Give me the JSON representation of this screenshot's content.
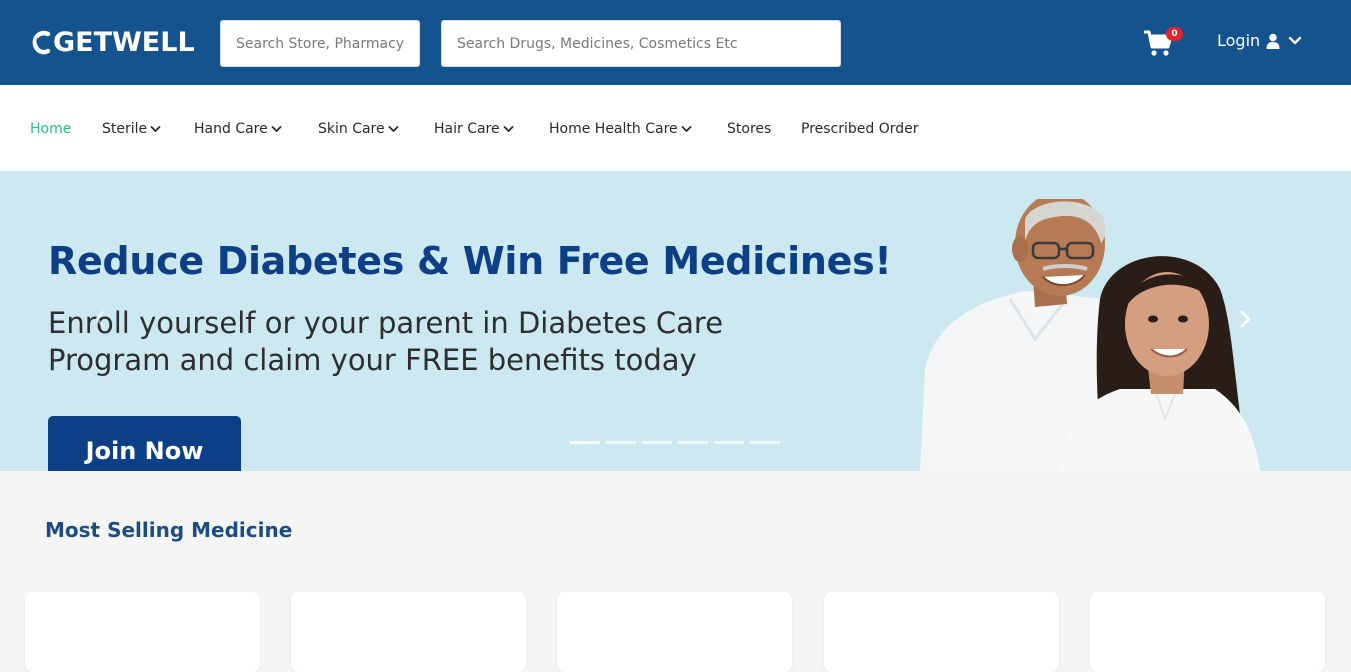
{
  "header": {
    "logo_text": "GETWELL",
    "store_search_placeholder": "Search Store, Pharmacy",
    "drug_search_placeholder": "Search Drugs, Medicines, Cosmetics Etc",
    "cart_count": "0",
    "login_label": "Login"
  },
  "nav": {
    "items": [
      {
        "label": "Home",
        "active": true
      },
      {
        "label": "Sterile",
        "dropdown": true
      },
      {
        "label": "Hand Care",
        "dropdown": true
      },
      {
        "label": "Skin Care",
        "dropdown": true
      },
      {
        "label": "Hair Care",
        "dropdown": true
      },
      {
        "label": "Home Health Care",
        "dropdown": true
      },
      {
        "label": "Stores"
      },
      {
        "label": "Prescribed Order"
      }
    ]
  },
  "banner": {
    "title": "Reduce Diabetes & Win Free Medicines!",
    "subtitle": "Enroll yourself or your parent in Diabetes Care Program and claim your FREE benefits today",
    "cta": "Join Now",
    "slide_count": 6,
    "active_slide": 1
  },
  "section": {
    "title": "Most Selling Medicine"
  },
  "colors": {
    "header_bg": "#15538f",
    "nav_active": "#2cc185",
    "banner_bg": "#cce9f1",
    "brand_navy": "#0d3f86",
    "badge_red": "#e0242e"
  },
  "icons": [
    "cart-icon",
    "user-icon",
    "chevron-down-icon",
    "chevron-right-icon",
    "chevron-left-icon"
  ]
}
